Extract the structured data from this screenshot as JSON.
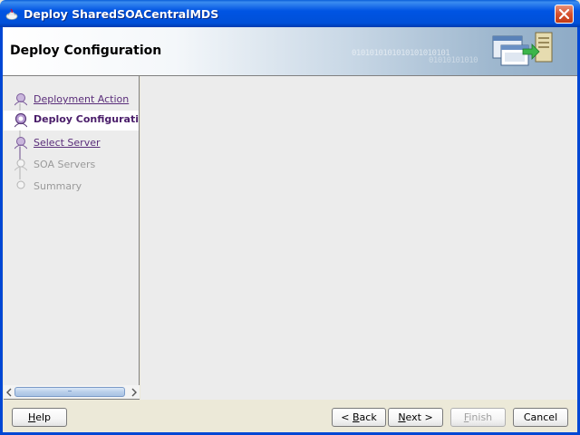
{
  "window": {
    "title": "Deploy SharedSOACentralMDS",
    "icon": "oracle-jdeveloper-icon"
  },
  "header": {
    "title": "Deploy Configuration",
    "binary_text_1": "0101010101010101010101",
    "binary_text_2": "01010101010"
  },
  "steps": [
    {
      "label": "Deployment Action",
      "state": "visited"
    },
    {
      "label": "Deploy Configuration",
      "state": "current"
    },
    {
      "label": "Select Server",
      "state": "visited"
    },
    {
      "label": "SOA Servers",
      "state": "disabled"
    },
    {
      "label": "Summary",
      "state": "disabled"
    }
  ],
  "buttons": {
    "help": {
      "mnemonic": "H",
      "rest": "elp"
    },
    "back": {
      "prefix": "< ",
      "mnemonic": "B",
      "rest": "ack"
    },
    "next": {
      "mnemonic": "N",
      "rest": "ext >"
    },
    "finish": {
      "mnemonic": "F",
      "rest": "inish"
    },
    "cancel": {
      "label": "Cancel"
    }
  },
  "colors": {
    "titlebar": "#0054e3",
    "link": "#5a2d7a",
    "current_step": "#4a1d6a",
    "disabled": "#9a9a9a"
  }
}
